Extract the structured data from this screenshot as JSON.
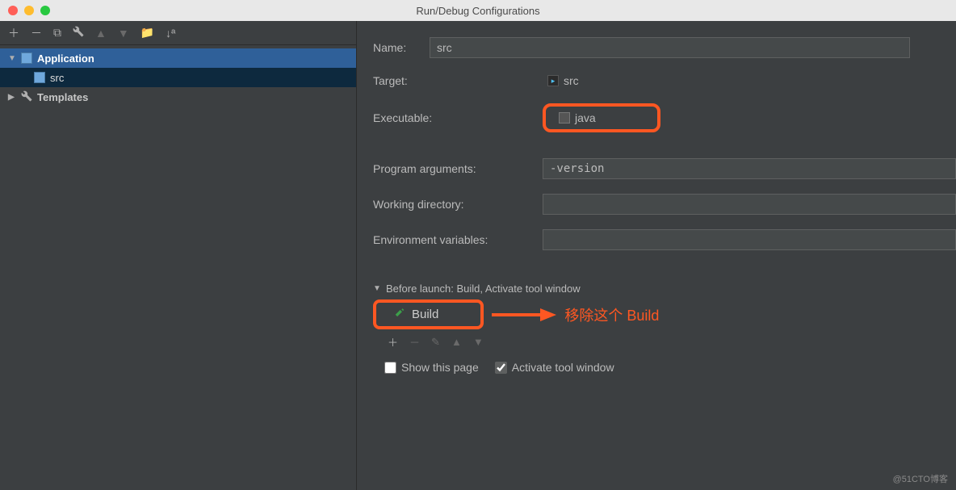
{
  "window": {
    "title": "Run/Debug Configurations"
  },
  "tree": {
    "application": "Application",
    "src": "src",
    "templates": "Templates"
  },
  "form": {
    "name_label": "Name:",
    "name_value": "src",
    "target_label": "Target:",
    "target_value": "src",
    "exec_label": "Executable:",
    "exec_value": "java",
    "args_label": "Program arguments:",
    "args_value": "-version",
    "wd_label": "Working directory:",
    "wd_value": "",
    "env_label": "Environment variables:",
    "env_value": ""
  },
  "before_launch": {
    "header": "Before launch: Build, Activate tool window",
    "build": "Build",
    "annotation": "移除这个 Build"
  },
  "checks": {
    "show_page": "Show this page",
    "activate": "Activate tool window"
  },
  "watermark": "@51CTO博客"
}
